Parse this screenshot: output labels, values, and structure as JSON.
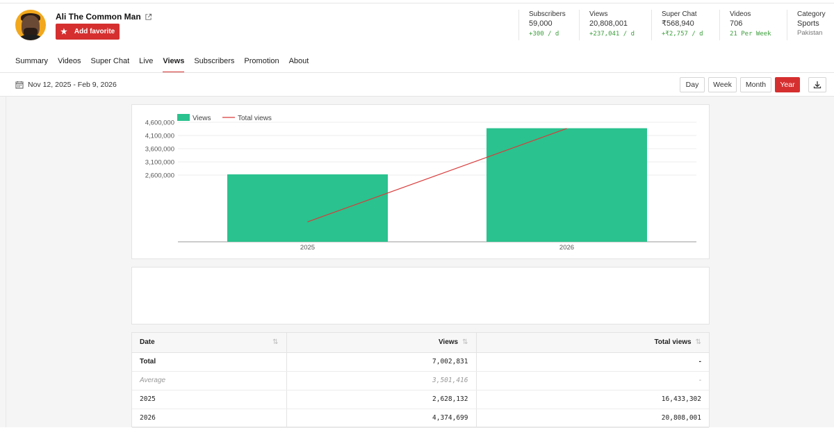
{
  "channel": {
    "name": "Ali The Common Man",
    "add_favorite": "Add favorite"
  },
  "stats": [
    {
      "label": "Subscribers",
      "value": "59,000",
      "delta": "+300 / d"
    },
    {
      "label": "Views",
      "value": "20,808,001",
      "delta": "+237,041 / d"
    },
    {
      "label": "Super Chat",
      "value": "₹568,940",
      "delta": "+₹2,757 / d"
    },
    {
      "label": "Videos",
      "value": "706",
      "delta": "21 Per Week"
    },
    {
      "label": "Category",
      "value": "Sports",
      "sub": "Pakistan"
    }
  ],
  "tabs": [
    "Summary",
    "Videos",
    "Super Chat",
    "Live",
    "Views",
    "Subscribers",
    "Promotion",
    "About"
  ],
  "active_tab": "Views",
  "date_range": "Nov 12, 2025 - Feb 9, 2026",
  "periods": [
    "Day",
    "Week",
    "Month",
    "Year"
  ],
  "active_period": "Year",
  "colors": {
    "accent": "#d62f2f",
    "bar": "#2ac28e",
    "line": "#d93a3a",
    "delta": "#3a9d3a"
  },
  "chart_data": {
    "type": "bar",
    "categories": [
      "2025",
      "2026"
    ],
    "series": [
      {
        "name": "Views",
        "kind": "bar",
        "values": [
          2628132,
          4374699
        ]
      },
      {
        "name": "Total views",
        "kind": "line",
        "values": [
          16433302,
          20808001
        ]
      }
    ],
    "y_ticks": [
      "4,600,000",
      "4,100,000",
      "3,600,000",
      "3,100,000",
      "2,600,000"
    ],
    "legend": "top-left",
    "grid": true
  },
  "table": {
    "headers": [
      "Date",
      "Views",
      "Total views"
    ],
    "rows": [
      {
        "date": "Total",
        "views": "7,002,831",
        "total": "-"
      },
      {
        "date": "Average",
        "views": "3,501,416",
        "total": "-"
      },
      {
        "date": "2025",
        "views": "2,628,132",
        "total": "16,433,302"
      },
      {
        "date": "2026",
        "views": "4,374,699",
        "total": "20,808,001"
      }
    ]
  }
}
